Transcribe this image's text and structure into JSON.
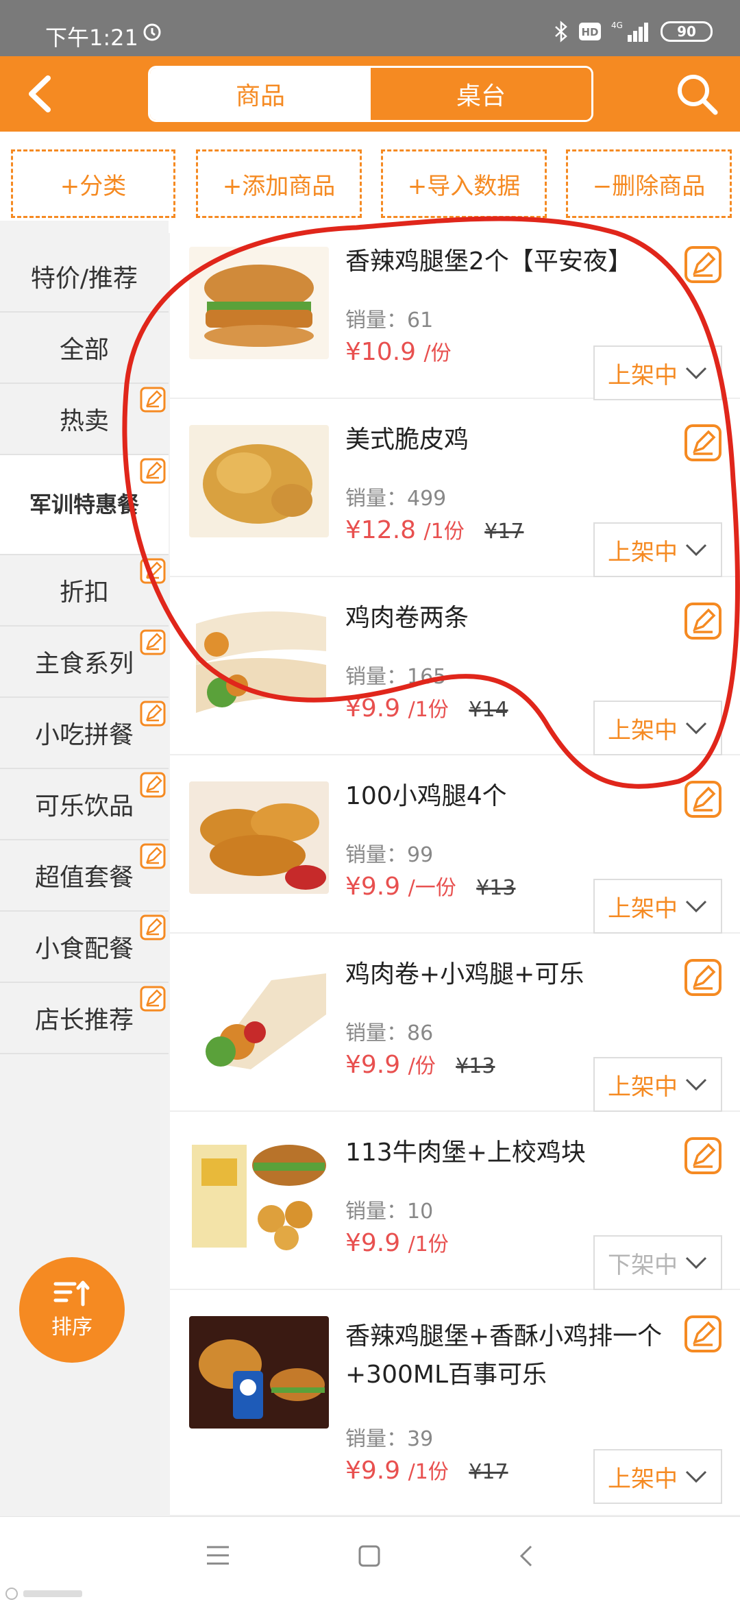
{
  "status_bar": {
    "time": "下午1:21",
    "battery": "90",
    "network": "4G"
  },
  "header": {
    "tabs": [
      {
        "label": "商品",
        "active": true
      },
      {
        "label": "桌台",
        "active": false
      }
    ]
  },
  "actions": [
    "+分类",
    "+添加商品",
    "+导入数据",
    "−删除商品"
  ],
  "sidebar": {
    "categories": [
      {
        "label": "特价/推荐",
        "active": false,
        "editable": false
      },
      {
        "label": "全部",
        "active": false,
        "editable": false
      },
      {
        "label": "热卖",
        "active": false,
        "editable": true
      },
      {
        "label": "军训特惠餐",
        "active": true,
        "editable": true
      },
      {
        "label": "折扣",
        "active": false,
        "editable": true
      },
      {
        "label": "主食系列",
        "active": false,
        "editable": true
      },
      {
        "label": "小吃拼餐",
        "active": false,
        "editable": true
      },
      {
        "label": "可乐饮品",
        "active": false,
        "editable": true
      },
      {
        "label": "超值套餐",
        "active": false,
        "editable": true
      },
      {
        "label": "小食配餐",
        "active": false,
        "editable": true
      },
      {
        "label": "店长推荐",
        "active": false,
        "editable": true
      }
    ],
    "sort_label": "排序"
  },
  "products": [
    {
      "name": "香辣鸡腿堡2个【平安夜】",
      "sales": "销量：61",
      "price": "¥10.9",
      "unit": "/份",
      "original": "",
      "status": "上架中",
      "on_shelf": true
    },
    {
      "name": "美式脆皮鸡",
      "sales": "销量：499",
      "price": "¥12.8",
      "unit": "/1份",
      "original": "¥17",
      "status": "上架中",
      "on_shelf": true
    },
    {
      "name": "鸡肉卷两条",
      "sales": "销量：165",
      "price": "¥9.9",
      "unit": "/1份",
      "original": "¥14",
      "status": "上架中",
      "on_shelf": true
    },
    {
      "name": "100小鸡腿4个",
      "sales": "销量：99",
      "price": "¥9.9",
      "unit": "/一份",
      "original": "¥13",
      "status": "上架中",
      "on_shelf": true
    },
    {
      "name": "鸡肉卷+小鸡腿+可乐",
      "sales": "销量：86",
      "price": "¥9.9",
      "unit": "/份",
      "original": "¥13",
      "status": "上架中",
      "on_shelf": true
    },
    {
      "name": "113牛肉堡+上校鸡块",
      "sales": "销量：10",
      "price": "¥9.9",
      "unit": "/1份",
      "original": "",
      "status": "下架中",
      "on_shelf": false
    },
    {
      "name": "香辣鸡腿堡+香酥小鸡排一个+300ML百事可乐",
      "sales": "销量：39",
      "price": "¥9.9",
      "unit": "/1份",
      "original": "¥17",
      "status": "上架中",
      "on_shelf": true
    }
  ],
  "icons": {
    "back": "chevron-left-icon",
    "search": "search-icon",
    "edit": "edit-icon",
    "dropdown": "chevron-down-icon",
    "sort": "sort-icon"
  },
  "colors": {
    "accent": "#f58a22",
    "price": "#e8504f",
    "annotation": "#e0261b"
  }
}
